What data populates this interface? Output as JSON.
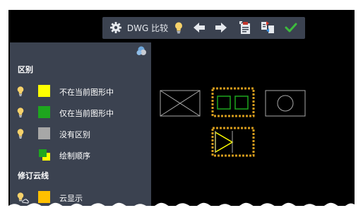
{
  "toolbar": {
    "settings_icon": "gear-icon",
    "title": "DWG 比较",
    "buttons": [
      "lightbulb-icon",
      "arrow-left-icon",
      "arrow-right-icon",
      "clipboard-import-icon",
      "swap-files-icon",
      "checkmark-icon"
    ]
  },
  "panel": {
    "sections": [
      {
        "title": "区别",
        "items": [
          {
            "label": "不在当前图形中",
            "color": "#ffff00",
            "bulb": true
          },
          {
            "label": "仅在当前图形中",
            "color": "#1ea61e",
            "bulb": true
          },
          {
            "label": "没有区别",
            "color": "#a7a7a7",
            "bulb": true
          },
          {
            "label": "绘制顺序",
            "color": "#ffff00",
            "bulb": false
          }
        ]
      },
      {
        "title": "修订云线",
        "items": [
          {
            "label": "云显示",
            "color": "#ffc000",
            "bulb": true
          }
        ]
      }
    ]
  },
  "colors": {
    "background": "#000000",
    "panel": "#3b4250",
    "highlight": "#d49a1c",
    "added": "#1ea61e",
    "removed": "#ffff00",
    "unchanged": "#a7a7a7"
  }
}
